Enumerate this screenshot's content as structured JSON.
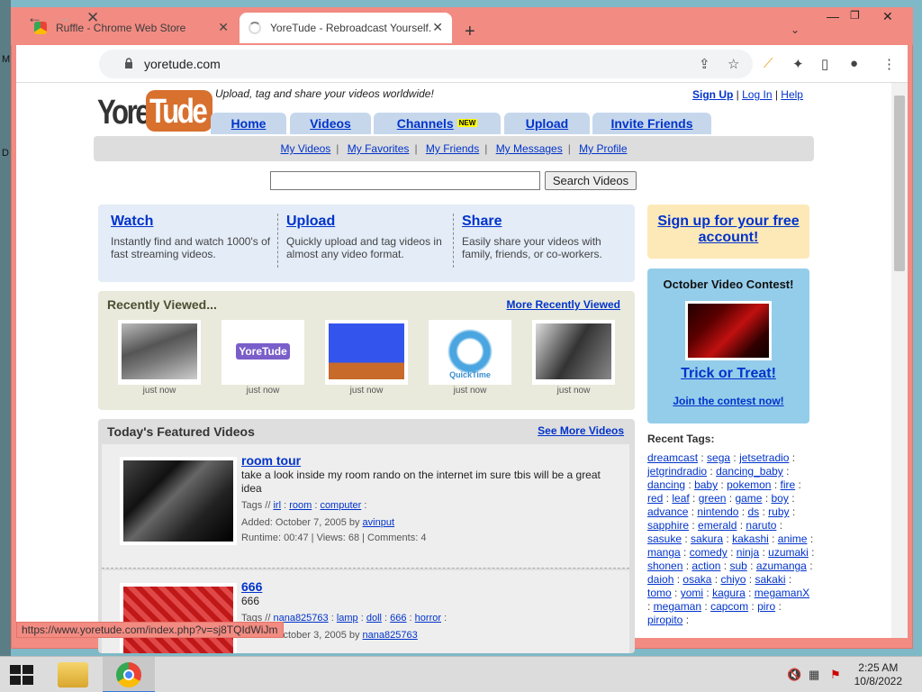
{
  "desktop": {
    "side_labels": [
      "M",
      "D"
    ]
  },
  "browser": {
    "tabs": [
      {
        "title": "Ruffle - Chrome Web Store"
      },
      {
        "title": "YoreTude - Rebroadcast Yourself."
      }
    ],
    "url": "yoretude.com",
    "status_url": "https://www.yoretude.com/index.php?v=sj8TQIdWiJm"
  },
  "site": {
    "logo_left": "Yore",
    "logo_right": "Tude",
    "tagline": "Upload, tag and share your videos worldwide!",
    "top_links": [
      "Sign Up",
      "Log In",
      "Help"
    ],
    "nav_tabs": [
      "Home",
      "Videos",
      "Channels",
      "Upload",
      "Invite Friends"
    ],
    "new_badge": "NEW",
    "sub_nav": [
      "My Videos",
      "My Favorites",
      "My Friends",
      "My Messages",
      "My Profile"
    ],
    "search_button": "Search Videos",
    "intro": [
      {
        "heading": "Watch",
        "text": "Instantly find and watch 1000's of fast streaming videos."
      },
      {
        "heading": "Upload",
        "text": "Quickly upload and tag videos in almost any video format."
      },
      {
        "heading": "Share",
        "text": "Easily share your videos with family, friends, or co-workers."
      }
    ],
    "signup_box": "Sign up for your free account!",
    "contest": {
      "title": "October Video Contest!",
      "link": "Trick or Treat!",
      "join": "Join the contest now!"
    },
    "recent": {
      "title": "Recently Viewed...",
      "more": "More Recently Viewed",
      "items": [
        "just now",
        "just now",
        "just now",
        "just now",
        "just now"
      ],
      "thumb_labels": [
        "",
        "YoreTude",
        "",
        "QuickTime",
        ""
      ]
    },
    "featured": {
      "title": "Today's Featured Videos",
      "more": "See More Videos",
      "videos": [
        {
          "title": "room tour",
          "desc": "take a look inside my room rando on the internet im sure tbis will be a great idea",
          "tags_label": "Tags //",
          "tags": [
            "irl",
            "room",
            "computer"
          ],
          "added_label": "Added: October 7, 2005 by",
          "user": "avinput",
          "stats": "Runtime: 00:47 | Views: 68 | Comments: 4"
        },
        {
          "title": "666",
          "desc": "666",
          "tags_label": "Tags //",
          "tags": [
            "nana825763",
            "lamp",
            "doll",
            "666",
            "horror"
          ],
          "added_label": "Added: October 3, 2005 by",
          "user": "nana825763",
          "stats": ""
        }
      ]
    },
    "recent_tags": {
      "title": "Recent Tags:",
      "tags": [
        "dreamcast",
        "sega",
        "jetsetradio",
        "jetgrindradio",
        "dancing_baby",
        "dancing",
        "baby",
        "pokemon",
        "fire",
        "red",
        "leaf",
        "green",
        "game",
        "boy",
        "advance",
        "nintendo",
        "ds",
        "ruby",
        "sapphire",
        "emerald",
        "naruto",
        "sasuke",
        "sakura",
        "kakashi",
        "anime",
        "manga",
        "comedy",
        "ninja",
        "uzumaki",
        "shonen",
        "action",
        "sub",
        "azumanga",
        "daioh",
        "osaka",
        "chiyo",
        "sakaki",
        "tomo",
        "yomi",
        "kagura",
        "megamanX",
        "megaman",
        "capcom",
        "piro",
        "piropito"
      ]
    }
  },
  "taskbar": {
    "time": "2:25 AM",
    "date": "10/8/2022"
  }
}
